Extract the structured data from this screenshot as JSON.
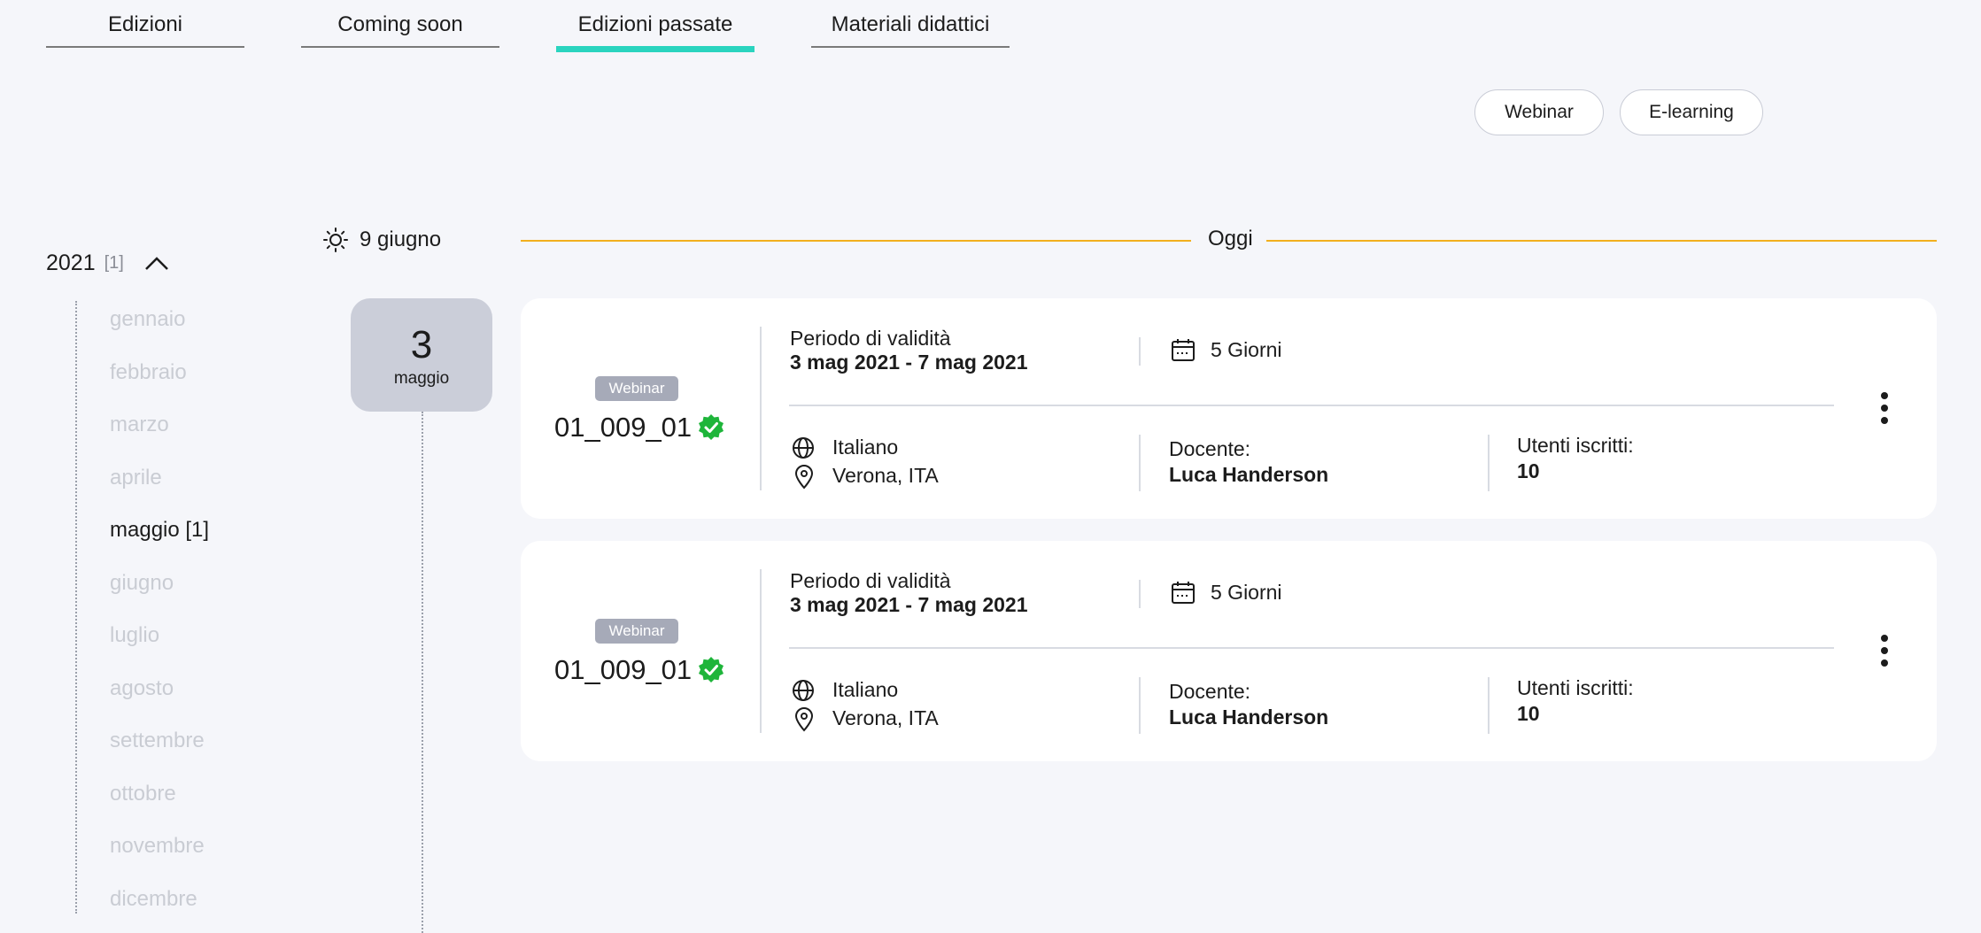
{
  "tabs": [
    {
      "label": "Edizioni"
    },
    {
      "label": "Coming soon"
    },
    {
      "label": "Edizioni passate"
    },
    {
      "label": "Materiali didattici"
    }
  ],
  "filters": {
    "webinar": "Webinar",
    "elearning": "E-learning"
  },
  "year": {
    "value": "2021",
    "count": "[1]"
  },
  "months": [
    {
      "label": "gennaio"
    },
    {
      "label": "febbraio"
    },
    {
      "label": "marzo"
    },
    {
      "label": "aprile"
    },
    {
      "label": "maggio [1]"
    },
    {
      "label": "giugno"
    },
    {
      "label": "luglio"
    },
    {
      "label": "agosto"
    },
    {
      "label": "settembre"
    },
    {
      "label": "ottobre"
    },
    {
      "label": "novembre"
    },
    {
      "label": "dicembre"
    }
  ],
  "today": {
    "date": "9 giugno",
    "label": "Oggi"
  },
  "day_badge": {
    "day": "3",
    "month": "maggio"
  },
  "cards": [
    {
      "type": "Webinar",
      "code": "01_009_01",
      "validity_label": "Periodo di validità",
      "validity_value": "3 mag 2021 - 7 mag 2021",
      "duration": "5 Giorni",
      "language": "Italiano",
      "location": "Verona, ITA",
      "teacher_label": "Docente:",
      "teacher_value": "Luca Handerson",
      "users_label": "Utenti iscritti:",
      "users_value": "10"
    },
    {
      "type": "Webinar",
      "code": "01_009_01",
      "validity_label": "Periodo di validità",
      "validity_value": "3 mag 2021 - 7 mag 2021",
      "duration": "5 Giorni",
      "language": "Italiano",
      "location": "Verona, ITA",
      "teacher_label": "Docente:",
      "teacher_value": "Luca Handerson",
      "users_label": "Utenti iscritti:",
      "users_value": "10"
    }
  ],
  "colors": {
    "accent": "#2ad4bf",
    "today_line": "#f2b01e",
    "verified": "#1eb53a",
    "badge": "#a6aab8"
  }
}
